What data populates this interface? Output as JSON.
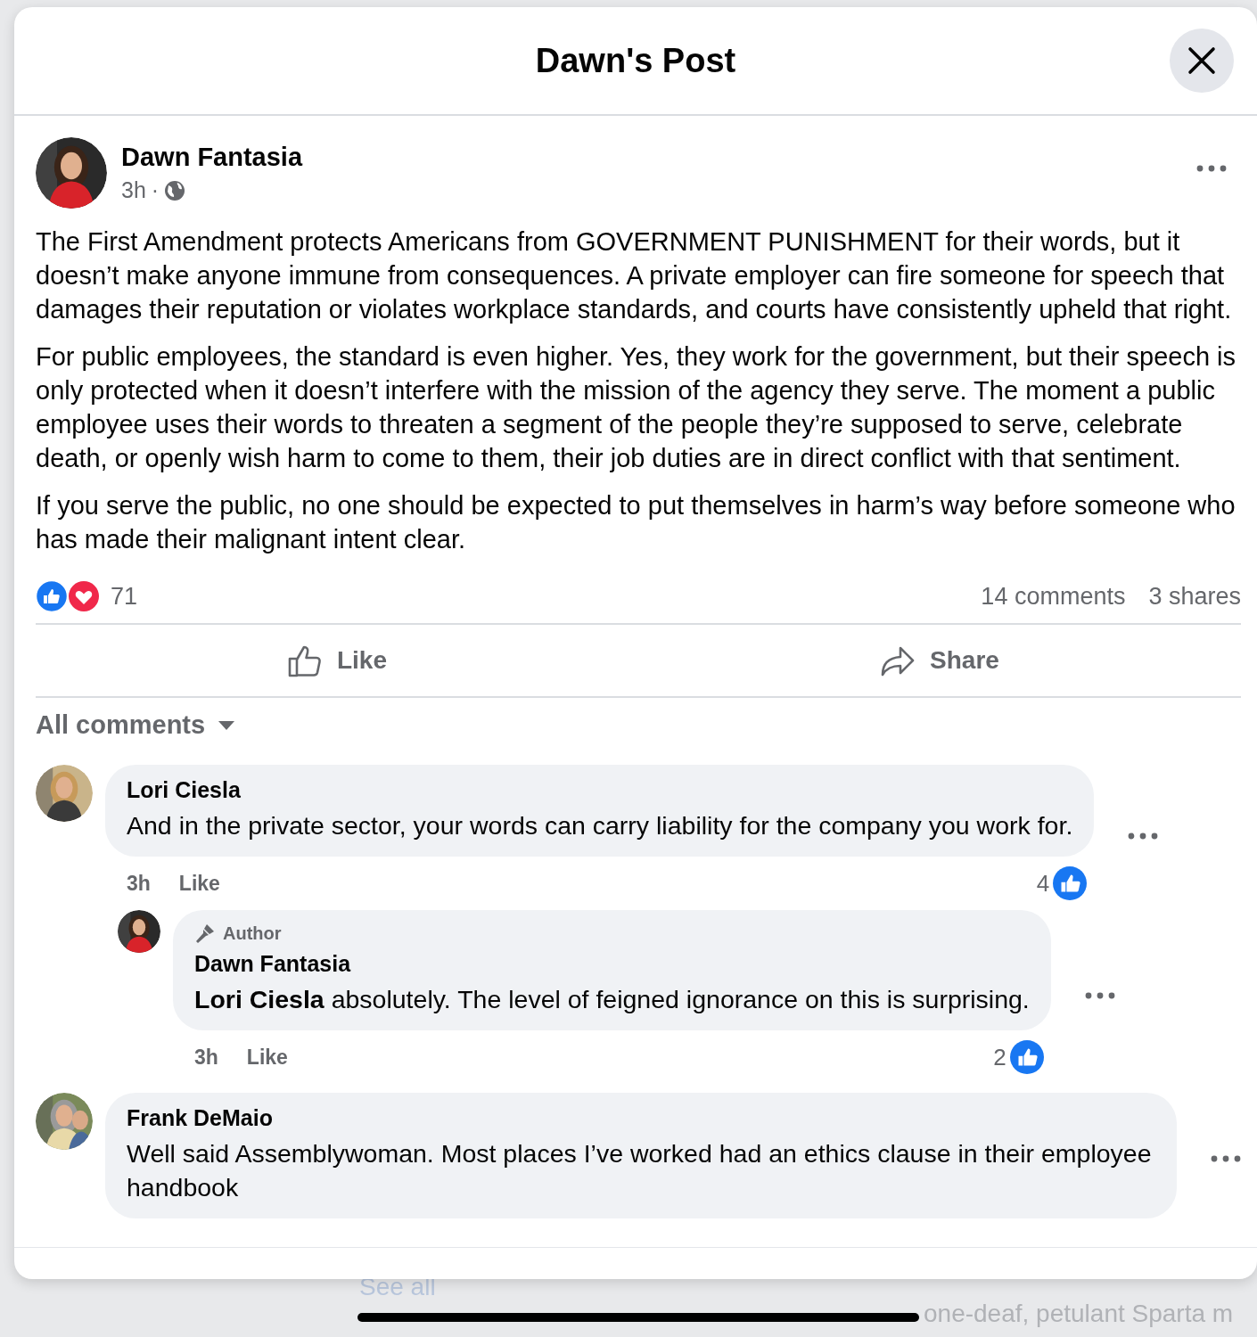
{
  "window": {
    "title": "Dawn's Post"
  },
  "post": {
    "author": "Dawn Fantasia",
    "time": "3h",
    "separator": "·",
    "paragraphs": [
      "The First Amendment protects Americans from GOVERNMENT PUNISHMENT for their words, but it doesn’t make anyone immune from consequences. A private employer can fire someone for speech that damages their reputation or violates workplace standards, and courts have consistently upheld that right.",
      "For public employees, the standard is even higher. Yes, they work for the government, but their speech is only protected when it doesn’t interfere with the mission of the agency they serve. The moment a public employee uses their words to threaten a segment of the people they’re supposed to serve, celebrate death, or openly wish harm to come to them, their job duties are in direct conflict with that sentiment.",
      "If you serve the public, no one should be expected to put themselves in harm’s way before someone who has made their malignant intent clear."
    ],
    "reaction_count": "71",
    "comments_count": "14 comments",
    "shares_count": "3 shares"
  },
  "actions": [
    {
      "label": "Like",
      "kind": "like"
    },
    {
      "label": "Share",
      "kind": "share"
    }
  ],
  "comments_filter": "All comments",
  "comments": [
    {
      "author": "Lori Ciesla",
      "text": "And in the private sector, your words can carry liability for the company you work for.",
      "time": "3h",
      "action": "Like",
      "likes": "4",
      "replies": [
        {
          "badge": "Author",
          "author": "Dawn Fantasia",
          "text": "**Lori Ciesla** absolutely. The level of feigned ignorance on this is surprising.",
          "time": "3h",
          "action": "Like",
          "likes": "2"
        }
      ]
    },
    {
      "author": "Frank DeMaio",
      "text": "Well said Assemblywoman. Most places I’ve worked had an ethics clause in their employee handbook"
    }
  ],
  "background": {
    "link": "See all",
    "text": "one-deaf, petulant Sparta m"
  }
}
